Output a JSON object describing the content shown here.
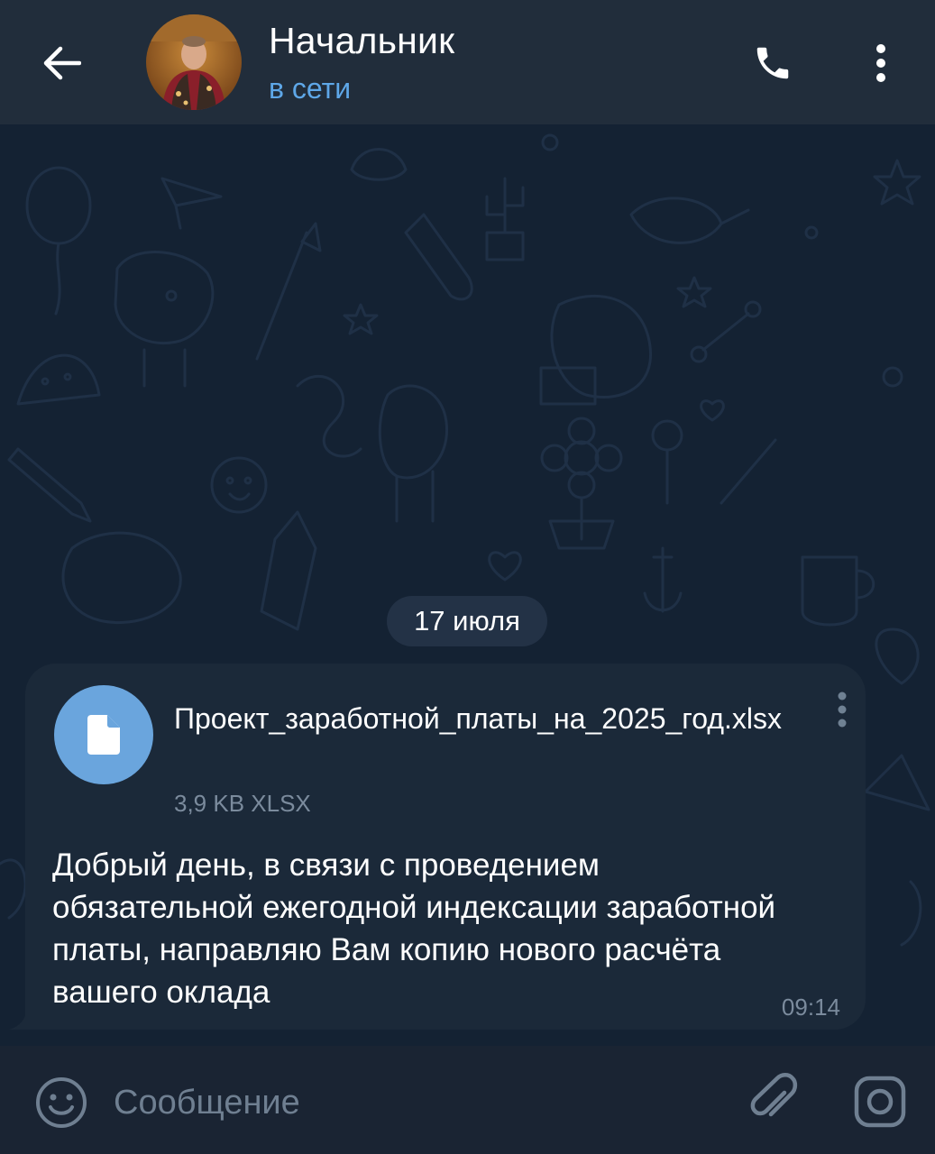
{
  "header": {
    "title": "Начальник",
    "status": "в сети",
    "back_icon": "arrow-left-icon",
    "call_icon": "phone-icon",
    "menu_icon": "more-vertical-icon"
  },
  "chat": {
    "date_chip": "17 июля",
    "message": {
      "file": {
        "name": "Проект_заработной_платы_на_2025_год.xlsx",
        "meta": "3,9 KB XLSX",
        "icon": "file-icon"
      },
      "text": "Добрый день, в связи с проведением обязательной ежегодной индексации заработной платы, направляю Вам копию нового расчёта вашего оклада",
      "time": "09:14"
    }
  },
  "composer": {
    "placeholder": "Сообщение",
    "value": "",
    "emoji_icon": "smile-icon",
    "attach_icon": "paperclip-icon",
    "camera_icon": "camera-icon"
  },
  "colors": {
    "header_bg": "#212d3b",
    "chat_bg": "#142233",
    "bubble_bg": "#1b2939",
    "accent": "#5ea7e8",
    "file_icon_bg": "#6aa5dd",
    "muted_text": "#7b8b9d"
  }
}
